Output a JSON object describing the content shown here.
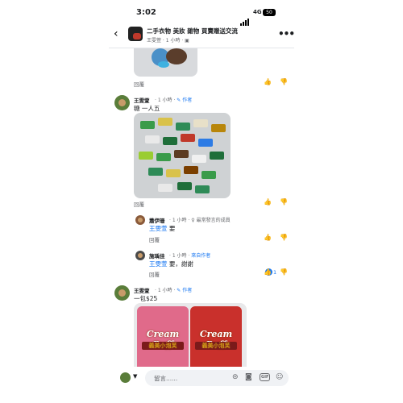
{
  "status_bar": {
    "time": "3:02",
    "network": "4G",
    "battery": "50"
  },
  "group": {
    "title": "二手衣物 美妝 雜物 買賣贈送交流",
    "subtitle": "王雯萱 · 1 小時 · "
  },
  "common": {
    "reply": "回覆"
  },
  "comments": [
    {
      "name": "王雯萱",
      "meta": "· 1 小時 · ",
      "badge": "✎ 作者",
      "text": "糖 一人五"
    },
    {
      "name": "蕭伊珊",
      "meta": "· 1 小時 · ",
      "badge": "♀ 最常發言的成員",
      "mention": "王雯萱",
      "text": " 要"
    },
    {
      "name": "施瑀佳",
      "meta": "· 1 小時 · ",
      "badge": "來自作者",
      "mention": "王雯萱",
      "text": " 要，謝謝",
      "likes": "1"
    },
    {
      "name": "王雯萱",
      "meta": "· 1 小時 · ",
      "badge": "✎ 作者",
      "text": "一包$25"
    }
  ],
  "product": {
    "brand": "Cream Puff",
    "sub": "義美小泡芙"
  },
  "composer": {
    "placeholder": "留言......"
  },
  "icons": [
    "back-icon",
    "more-icon",
    "like-icon",
    "dislike-icon",
    "camera-icon",
    "emoji-icon",
    "gif-icon"
  ]
}
